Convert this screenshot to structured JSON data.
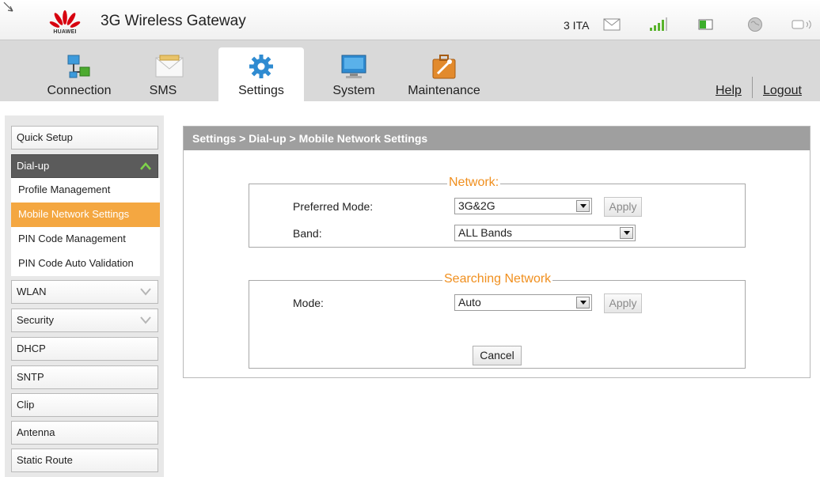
{
  "header": {
    "brand": "HUAWEI",
    "title": "3G Wireless Gateway",
    "carrier": "3 ITA"
  },
  "status_icons": [
    "mail-icon",
    "signal-icon",
    "battery-icon",
    "globe-icon",
    "wifi-status-icon"
  ],
  "nav": {
    "tabs": [
      {
        "label": "Connection",
        "icon": "connection-icon"
      },
      {
        "label": "SMS",
        "icon": "envelope-icon"
      },
      {
        "label": "Settings",
        "icon": "gear-icon",
        "active": true
      },
      {
        "label": "System",
        "icon": "monitor-icon"
      },
      {
        "label": "Maintenance",
        "icon": "toolbox-icon"
      }
    ],
    "help": "Help",
    "logout": "Logout"
  },
  "sidebar": {
    "items": [
      {
        "label": "Quick Setup"
      },
      {
        "label": "Dial-up",
        "expanded": true
      },
      {
        "label": "WLAN"
      },
      {
        "label": "Security"
      },
      {
        "label": "DHCP"
      },
      {
        "label": "SNTP"
      },
      {
        "label": "Clip"
      },
      {
        "label": "Antenna"
      },
      {
        "label": "Static Route"
      }
    ],
    "dialup_sub": [
      {
        "label": "Profile Management"
      },
      {
        "label": "Mobile Network Settings",
        "selected": true
      },
      {
        "label": "PIN Code Management"
      },
      {
        "label": "PIN Code Auto Validation"
      }
    ]
  },
  "panel": {
    "breadcrumb": "Settings > Dial-up > Mobile Network Settings",
    "network": {
      "legend": "Network",
      "preferred_mode_label": "Preferred Mode:",
      "preferred_mode_value": "3G&2G",
      "band_label": "Band:",
      "band_value": "ALL Bands",
      "apply": "Apply"
    },
    "searching": {
      "legend": "Searching Network",
      "mode_label": "Mode:",
      "mode_value": "Auto",
      "apply": "Apply",
      "cancel": "Cancel"
    }
  },
  "colors": {
    "accent": "#f4a741",
    "legend": "#f08f1e",
    "panel_header": "#9f9f9f",
    "menubar": "#d9d9d9"
  }
}
